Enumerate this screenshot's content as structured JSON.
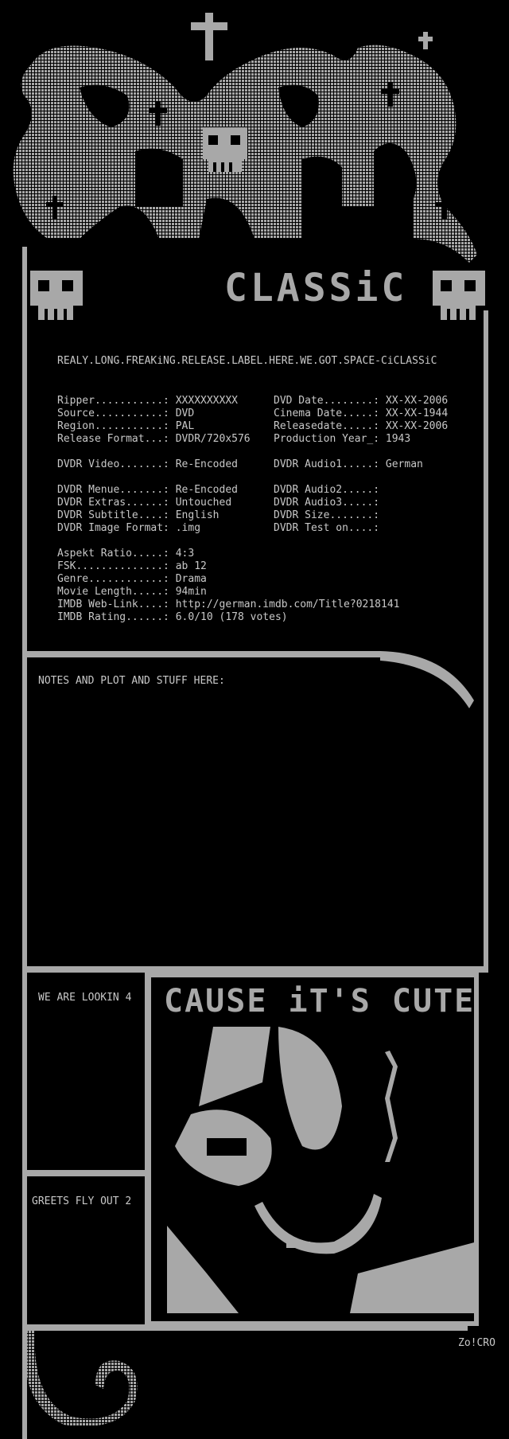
{
  "header": {
    "logo_word": "CLASSiC",
    "release_label": "REALY.LONG.FREAKiNG.RELEASE.LABEL.HERE.WE.GOT.SPACE-CiCLASSiC"
  },
  "info_left": [
    {
      "label": "Ripper...........:",
      "value": "XXXXXXXXXX"
    },
    {
      "label": "Source...........:",
      "value": "DVD"
    },
    {
      "label": "Region...........:",
      "value": "PAL"
    },
    {
      "label": "Release Format...:",
      "value": "DVDR/720x576"
    },
    {
      "label": "DVDR Video.......:",
      "value": "Re-Encoded"
    },
    {
      "label": "DVDR Menue.......:",
      "value": "Re-Encoded"
    },
    {
      "label": "DVDR Extras......:",
      "value": "Untouched"
    },
    {
      "label": "DVDR Subtitle....:",
      "value": "English"
    },
    {
      "label": "DVDR Image Format:",
      "value": ".img"
    }
  ],
  "info_right": [
    {
      "label": "DVD Date........:",
      "value": "XX-XX-2006"
    },
    {
      "label": "Cinema Date.....:",
      "value": "XX-XX-1944"
    },
    {
      "label": "Releasedate.....:",
      "value": "XX-XX-2006"
    },
    {
      "label": "Production Year_:",
      "value": "1943"
    },
    {
      "label": "DVDR Audio1.....:",
      "value": "German"
    },
    {
      "label": "DVDR Audio2.....:",
      "value": ""
    },
    {
      "label": "DVDR Audio3.....:",
      "value": ""
    },
    {
      "label": "DVDR Size.......:",
      "value": ""
    },
    {
      "label": "DVDR Test on....:",
      "value": ""
    }
  ],
  "info_bottom": [
    {
      "label": "Aspekt Ratio.....:",
      "value": "4:3"
    },
    {
      "label": "FSK..............:",
      "value": "ab 12"
    },
    {
      "label": "Genre............:",
      "value": "Drama"
    },
    {
      "label": "Movie Length.....:",
      "value": "94min"
    },
    {
      "label": "IMDB Web-Link....:",
      "value": "http://german.imdb.com/Title?0218141"
    },
    {
      "label": "IMDB Rating......:",
      "value": "6.0/10 (178 votes)"
    }
  ],
  "notes": "NOTES AND PLOT AND STUFF HERE:",
  "lookin": "WE ARE LOOKIN 4",
  "greets": "GREETS FLY OUT 2",
  "cute_banner": "CAUSE iT'S CUTE",
  "signature": "Zo!CRO",
  "colors": {
    "background": "#000000",
    "art": "#a8a8a8",
    "text": "#c8c8c8"
  }
}
